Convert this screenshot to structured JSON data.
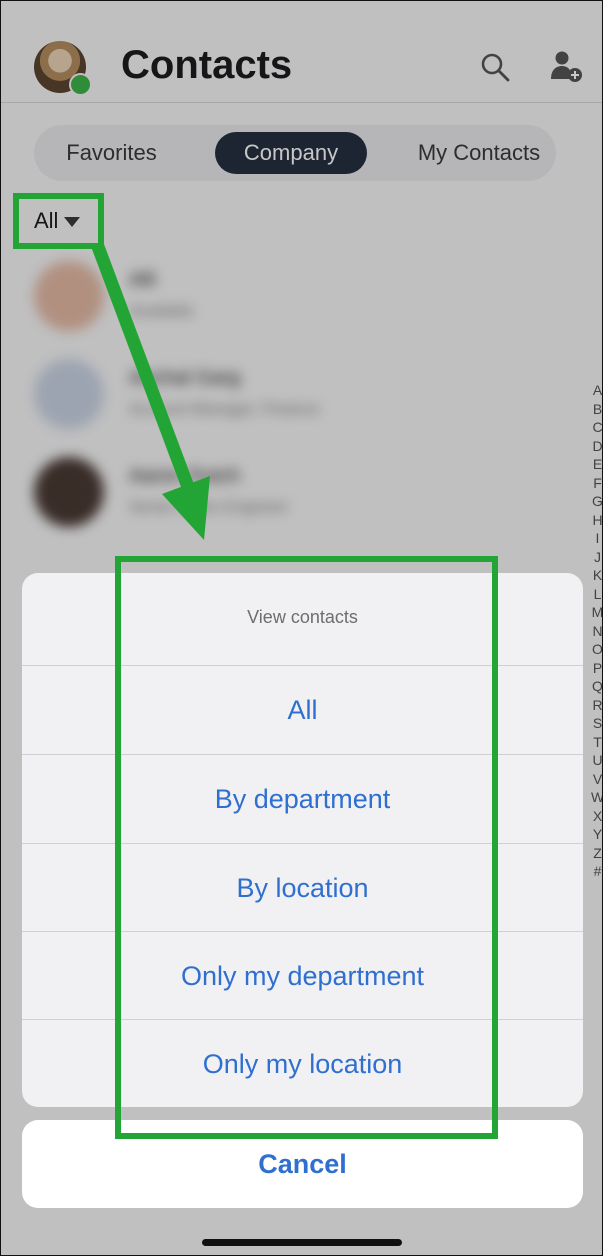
{
  "header": {
    "title": "Contacts"
  },
  "tabs": [
    {
      "label": "Favorites"
    },
    {
      "label": "Company"
    },
    {
      "label": "My Contacts"
    }
  ],
  "filter": {
    "label": "All"
  },
  "contacts": [
    {
      "name": "Alli",
      "subtitle": "Available"
    },
    {
      "name": "Anchal Garg",
      "subtitle": "Account Manager, Finance"
    },
    {
      "name": "Aaron Dutch",
      "subtitle": "Senior Sales Engineer"
    }
  ],
  "alphabet": [
    "A",
    "B",
    "C",
    "D",
    "E",
    "F",
    "G",
    "H",
    "I",
    "J",
    "K",
    "L",
    "M",
    "N",
    "O",
    "P",
    "Q",
    "R",
    "S",
    "T",
    "U",
    "V",
    "W",
    "X",
    "Y",
    "Z",
    "#"
  ],
  "action_sheet": {
    "title": "View contacts",
    "options": [
      {
        "label": "All"
      },
      {
        "label": "By department"
      },
      {
        "label": "By location"
      },
      {
        "label": "Only my department"
      },
      {
        "label": "Only my location"
      }
    ],
    "cancel_label": "Cancel"
  },
  "colors": {
    "accent": "#2f6fd0",
    "tab_active": "#263040",
    "annotation": "#22a534",
    "presence": "#3db54a"
  }
}
